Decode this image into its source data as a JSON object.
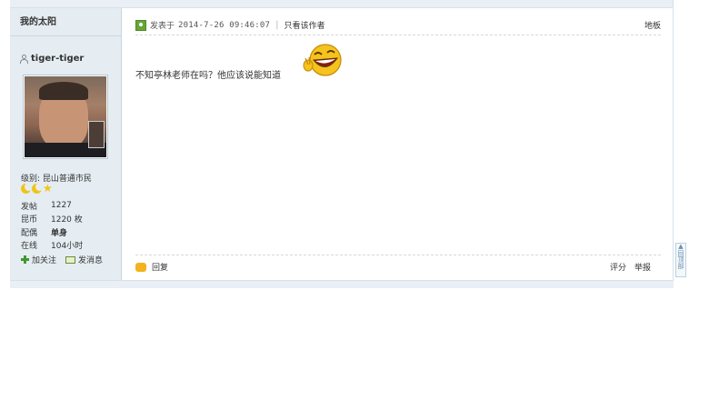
{
  "sidebar": {
    "title": "我的太阳",
    "username": "tiger-tiger",
    "level": "级别: 昆山普通市民",
    "stats": [
      {
        "label": "发帖",
        "value": "1227"
      },
      {
        "label": "昆币",
        "value": "1220 枚"
      },
      {
        "label": "配偶",
        "value": "单身"
      },
      {
        "label": "在线",
        "value": "104小时"
      }
    ],
    "follow_label": "加关注",
    "message_label": "发消息"
  },
  "post": {
    "posted_label": "发表于",
    "date": "2014-7-26 09:46:07",
    "only_author_label": "只看该作者",
    "floor_label": "地板",
    "message": "不知亭林老师在吗？他应该说能知道",
    "reply_label": "回复",
    "rate_label": "评分",
    "report_label": "举报"
  },
  "back_to_top": "回顶部",
  "colors": {
    "sidebar_bg": "#e5edf2",
    "strip_bg": "#e9eff5",
    "accent_green": "#67a53a",
    "accent_yellow": "#f0c419"
  }
}
